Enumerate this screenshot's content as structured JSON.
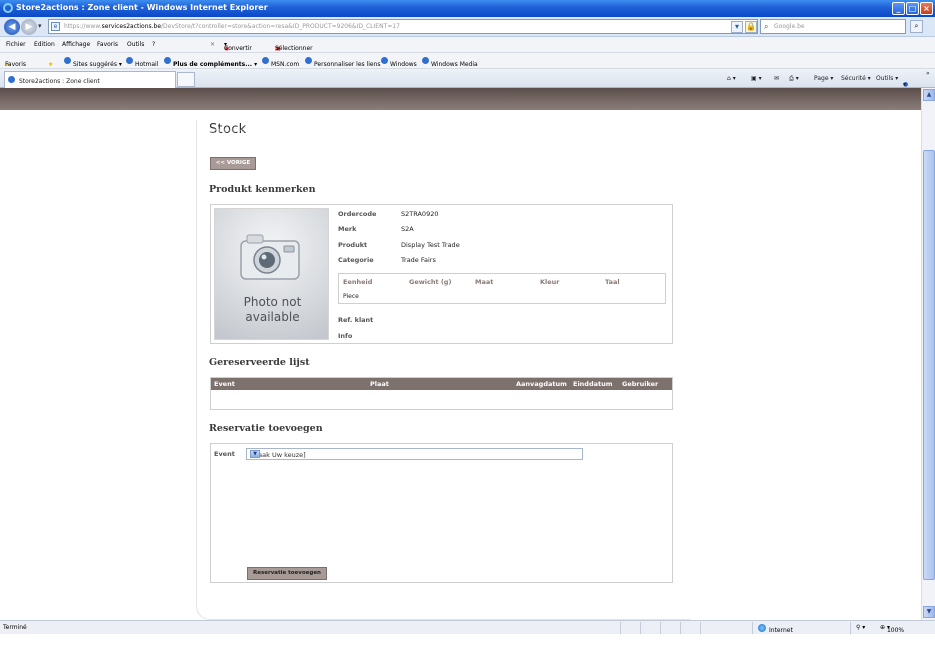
{
  "window": {
    "title": "Store2actions : Zone client - Windows Internet Explorer",
    "min": "_",
    "max": "□",
    "close": "×"
  },
  "address": {
    "url_prefix": "https://www.",
    "url_domain": "services2actions.be",
    "url_rest": "/DevStore/t?controller=store&action=resa&ID_PRODUCT=9206&ID_CLIENT=17",
    "search_placeholder": "Google.be"
  },
  "menu": {
    "items": [
      "Fichier",
      "Edition",
      "Affichage",
      "Favoris",
      "Outils",
      "?"
    ],
    "convert": "Convertir",
    "select": "Sélectionner"
  },
  "favorites": {
    "favoris": "Favoris",
    "links": [
      "Sites suggérés ▾",
      "Hotmail",
      "Plus de compléments... ▾",
      "MSN.com",
      "Personnaliser les liens",
      "Windows",
      "Windows Media"
    ]
  },
  "tab": {
    "label": "Store2actions : Zone client"
  },
  "command_bar": {
    "page": "Page ▾",
    "security": "Sécurité ▾",
    "tools": "Outils ▾",
    "help": "▾"
  },
  "page": {
    "title": "Stock",
    "prev_button": "<< VORIGE",
    "section_product": "Produkt kenmerken",
    "section_reserved": "Gereserveerde lijst",
    "section_add": "Reservatie toevoegen"
  },
  "product": {
    "photo_text_1": "Photo not",
    "photo_text_2": "available",
    "fields": [
      {
        "label": "Ordercode",
        "value": "S2TRA0920"
      },
      {
        "label": "Merk",
        "value": "S2A"
      },
      {
        "label": "Produkt",
        "value": "Display Test Trade"
      },
      {
        "label": "Categorie",
        "value": "Trade Fairs"
      }
    ],
    "spec_headers": [
      "Eenheid",
      "Gewicht (g)",
      "Maat",
      "Kleur",
      "Taal"
    ],
    "spec_values": [
      "Piece",
      "",
      "",
      "",
      ""
    ],
    "ref_label": "Ref. klant",
    "info_label": "Info"
  },
  "reserved_list": {
    "headers": [
      "Event",
      "Plaat",
      "Aanvagdatum",
      "Einddatum",
      "Gebruiker"
    ]
  },
  "add_reservation": {
    "event_label": "Event",
    "event_select": "[Maak Uw keuze]",
    "submit": "Reservatie toevoegen"
  },
  "status": {
    "left": "Terminé",
    "zone": "Internet",
    "zoom": "100%"
  }
}
